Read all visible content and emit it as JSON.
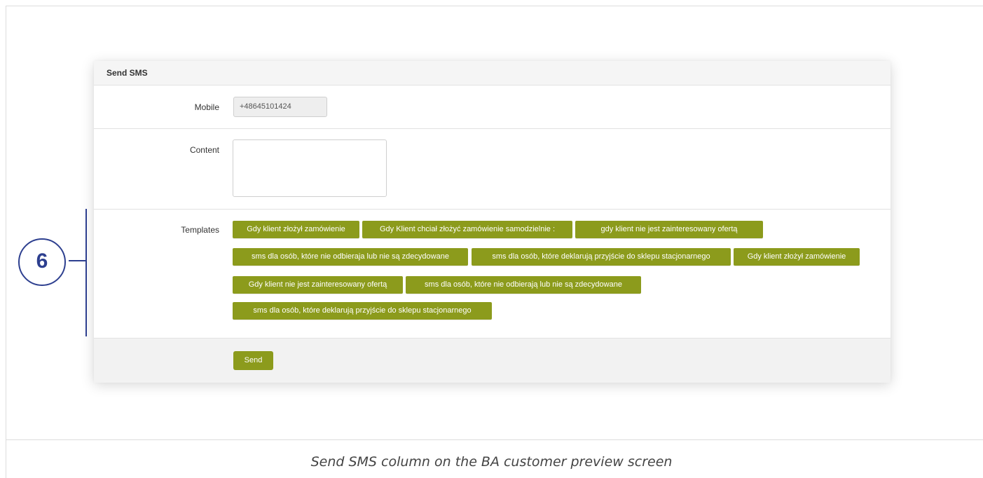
{
  "panel": {
    "title": "Send SMS"
  },
  "mobile": {
    "label": "Mobile",
    "value": "+48645101424"
  },
  "content": {
    "label": "Content",
    "value": ""
  },
  "templates": {
    "label": "Templates",
    "items": [
      "Gdy klient złożył zamówienie",
      "Gdy Klient chciał złożyć zamówienie samodzielnie :",
      "gdy klient nie jest zainteresowany ofertą",
      "sms dla osób, które nie odbieraja lub nie są zdecydowane",
      "sms dla osób, które deklarują przyjście do sklepu stacjonarnego",
      "Gdy klient złożył zamówienie",
      "Gdy klient nie jest zainteresowany ofertą",
      "sms dla osób, które nie odbierają lub nie są zdecydowane",
      "sms dla osób, które deklarują przyjście do sklepu stacjonarnego"
    ]
  },
  "actions": {
    "send_label": "Send"
  },
  "annotation": {
    "number": "6"
  },
  "caption": "Send SMS column on the BA customer preview screen",
  "colors": {
    "button": "#8c9b1c",
    "annotation": "#2d3f8f"
  }
}
